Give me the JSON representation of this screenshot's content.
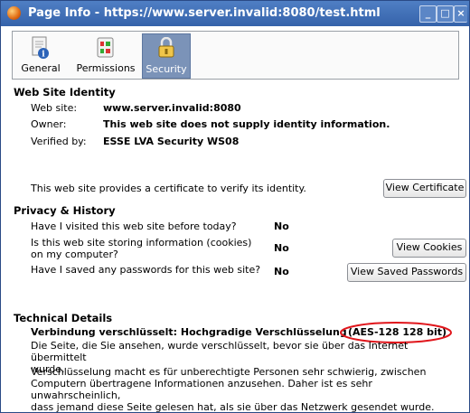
{
  "window": {
    "title": "Page Info - https://www.server.invalid:8080/test.html",
    "controls": [
      "_",
      "□",
      "×"
    ]
  },
  "tabs": [
    {
      "label": "General",
      "icon": "info-document-icon",
      "selected": false
    },
    {
      "label": "Permissions",
      "icon": "permissions-toggle-icon",
      "selected": false
    },
    {
      "label": "Security",
      "icon": "padlock-icon",
      "selected": true
    }
  ],
  "identity": {
    "title": "Web Site Identity",
    "website_label": "Web site:",
    "website_value": "www.server.invalid:8080",
    "owner_label": "Owner:",
    "owner_value": "This web site does not supply identity information.",
    "verified_label": "Verified by:",
    "verified_value": "ESSE LVA Security WS08",
    "cert_text": "This web site provides a certificate to verify its identity.",
    "view_cert_button": "View Certificate"
  },
  "privacy": {
    "title": "Privacy & History",
    "q1": "Have I visited this web site before today?",
    "a1": "No",
    "q2_line1": "Is this web site storing information (cookies)",
    "q2_line2": "on my computer?",
    "a2": "No",
    "cookies_button": "View Cookies",
    "q3": "Have I saved any passwords for this web site?",
    "a3": "No",
    "passwords_button": "View Saved Passwords"
  },
  "technical": {
    "title": "Technical Details",
    "headline": "Verbindung verschlüsselt: Hochgradige Verschlüsselung",
    "cipher": "(AES-128 128 bit)",
    "para1_line1": "Die Seite, die Sie ansehen, wurde verschlüsselt, bevor sie über das Internet übermittelt",
    "para1_line2": "wurde.",
    "para2_line1": "Verschlüsselung macht es für unberechtigte Personen sehr schwierig, zwischen",
    "para2_line2": "Computern übertragene Informationen anzusehen. Daher ist es sehr unwahrscheinlich,",
    "para2_line3": "dass jemand diese Seite gelesen hat, als sie über das Netzwerk gesendet wurde."
  },
  "colors": {
    "titlebar": "#3e6db5",
    "selected_tab": "#7b93b8",
    "annotation_circle": "#e0151b"
  }
}
